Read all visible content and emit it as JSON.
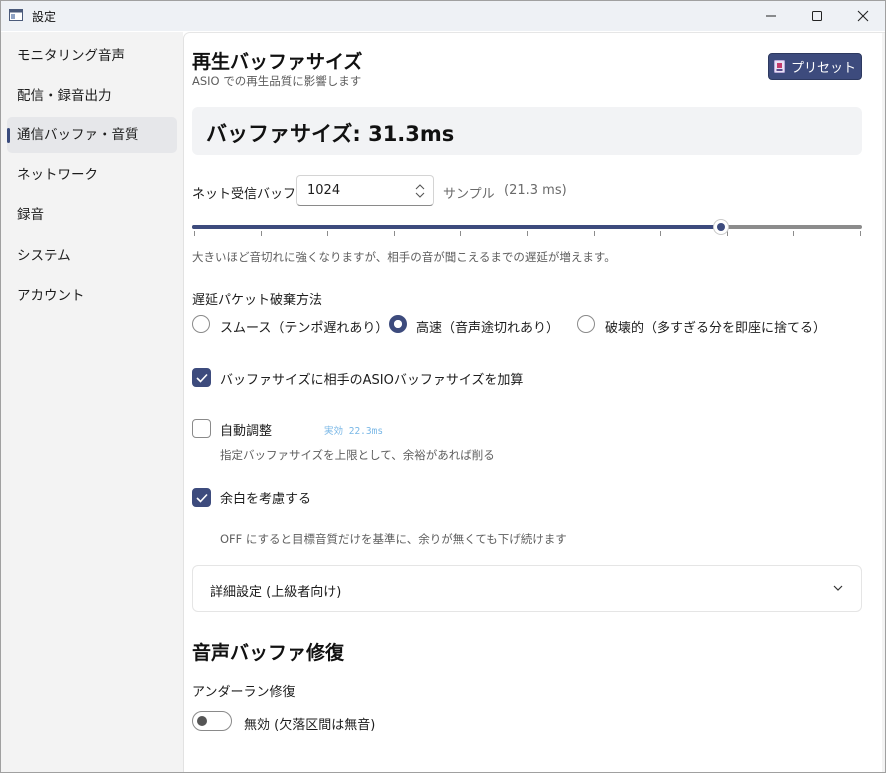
{
  "window": {
    "title": "設定",
    "controls": {
      "minimize": "minimize",
      "maximize": "maximize",
      "close": "close"
    }
  },
  "sidebar": {
    "items": [
      {
        "label": "モニタリング音声",
        "active": false
      },
      {
        "label": "配信・録音出力",
        "active": false
      },
      {
        "label": "通信バッファ・音質",
        "active": true
      },
      {
        "label": "ネットワーク",
        "active": false
      },
      {
        "label": "録音",
        "active": false
      },
      {
        "label": "システム",
        "active": false
      },
      {
        "label": "アカウント",
        "active": false
      }
    ]
  },
  "playback_buffer": {
    "title": "再生バッファサイズ",
    "subtitle": "ASIO での再生品質に影響します",
    "preset_label": "プリセット",
    "preset_icon": "preset-icon",
    "buffer_size_text": "バッファサイズ: 31.3ms",
    "net_buffer_label": "ネット受信バッファ",
    "net_buffer_value": "1024",
    "unit_label": "サンプル",
    "ms_value": "(21.3 ms)",
    "slider_fraction": 0.79,
    "slider_ticks": 11,
    "hint": "大きいほど音切れに強くなりますが、相手の音が聞こえるまでの遅延が増えます。"
  },
  "discard": {
    "label": "遅延パケット破棄方法",
    "options": [
      {
        "label": "スムース（テンポ遅れあり）",
        "selected": false
      },
      {
        "label": "高速（音声途切れあり）",
        "selected": true
      },
      {
        "label": "破壊的（多すぎる分を即座に捨てる）",
        "selected": false
      }
    ]
  },
  "options": {
    "add_asio": {
      "label": "バッファサイズに相手のASIOバッファサイズを加算",
      "checked": true
    },
    "auto_adjust": {
      "label": "自動調整",
      "checked": false,
      "effective": "実効 22.3ms",
      "hint": "指定バッファサイズを上限として、余裕があれば削る"
    },
    "margin": {
      "label": "余白を考慮する",
      "checked": true,
      "hint": "OFF にすると目標音質だけを基準に、余りが無くても下げ続けます"
    }
  },
  "advanced": {
    "label": "詳細設定 (上級者向け)"
  },
  "repair": {
    "title": "音声バッファ修復",
    "underrun_label": "アンダーラン修復",
    "toggle_label": "無効 (欠落区間は無音)",
    "toggle_on": false
  },
  "colors": {
    "accent": "#3d4b7d",
    "effective_text": "#79b7e6"
  }
}
